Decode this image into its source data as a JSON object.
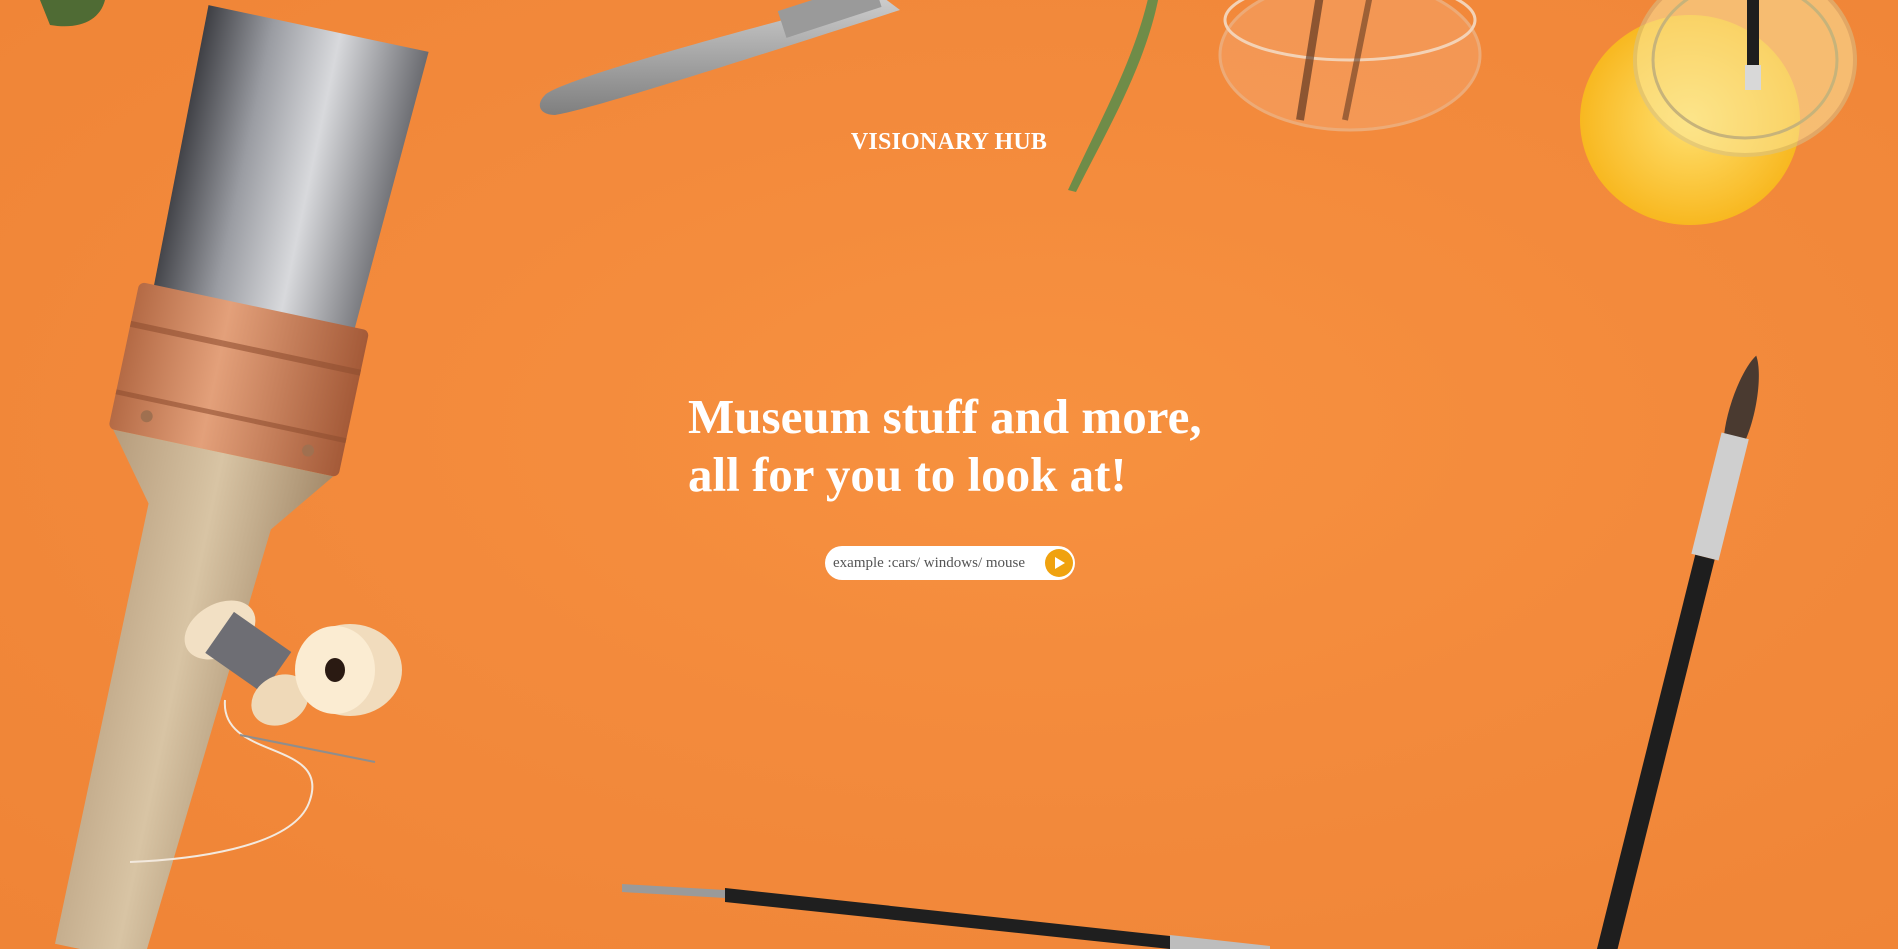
{
  "header": {
    "brand": "VISIONARY HUB"
  },
  "hero": {
    "headline_line1": "Museum stuff and more,",
    "headline_line2": "all for you to look at!"
  },
  "search": {
    "placeholder": "example :cars/ windows/ mouse",
    "value": "",
    "submit_icon": "play-arrow-icon"
  },
  "colors": {
    "background": "#f38a3d",
    "accent_button": "#f0a20f",
    "text": "#ffffff"
  },
  "decor_icons": [
    "paintbrush-icon",
    "thread-spool-icon",
    "needle-icon",
    "palette-knife-icon",
    "glass-jar-icon",
    "paint-jar-icon",
    "thin-brush-icon",
    "leaf-stem-icon"
  ]
}
